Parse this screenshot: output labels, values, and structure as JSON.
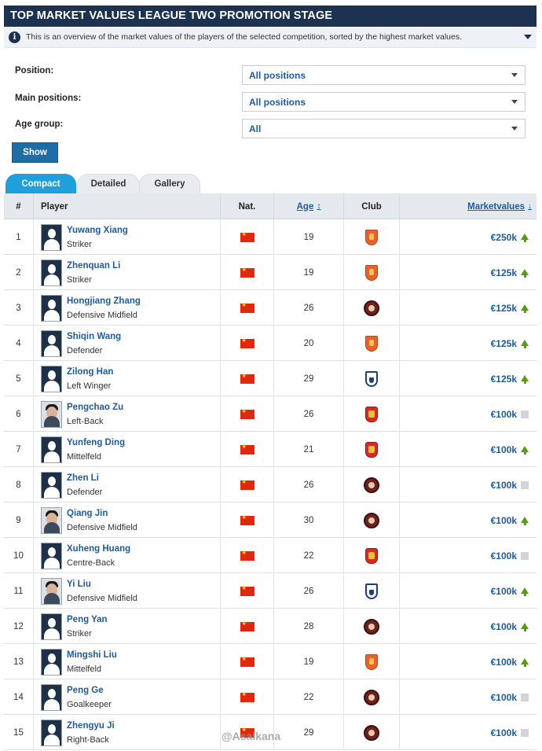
{
  "header": {
    "title": "TOP MARKET VALUES LEAGUE TWO PROMOTION STAGE",
    "info_text": "This is an overview of the market values of the players of the selected competition, sorted by the highest market values.",
    "info_icon": "info-icon"
  },
  "filters": {
    "position_label": "Position:",
    "position_value": "All positions",
    "main_positions_label": "Main positions:",
    "main_positions_value": "All positions",
    "age_group_label": "Age group:",
    "age_group_value": "All",
    "show_label": "Show"
  },
  "tabs": [
    {
      "label": "Compact",
      "active": true
    },
    {
      "label": "Detailed",
      "active": false
    },
    {
      "label": "Gallery",
      "active": false
    }
  ],
  "columns": {
    "num": "#",
    "player": "Player",
    "nat": "Nat.",
    "age": "Age",
    "club": "Club",
    "value": "Marketvalues"
  },
  "rows": [
    {
      "num": "1",
      "name": "Yuwang Xiang",
      "position": "Striker",
      "nat": "China",
      "age": "19",
      "club_crest": "orange",
      "value": "€250k",
      "trend": "up",
      "photo": false
    },
    {
      "num": "2",
      "name": "Zhenquan Li",
      "position": "Striker",
      "nat": "China",
      "age": "19",
      "club_crest": "orange",
      "value": "€125k",
      "trend": "up",
      "photo": false
    },
    {
      "num": "3",
      "name": "Hongjiang Zhang",
      "position": "Defensive Midfield",
      "nat": "China",
      "age": "26",
      "club_crest": "brown",
      "value": "€125k",
      "trend": "up",
      "photo": false
    },
    {
      "num": "4",
      "name": "Shiqin Wang",
      "position": "Defender",
      "nat": "China",
      "age": "20",
      "club_crest": "orange",
      "value": "€125k",
      "trend": "up",
      "photo": false
    },
    {
      "num": "5",
      "name": "Zilong Han",
      "position": "Left Winger",
      "nat": "China",
      "age": "29",
      "club_crest": "blue",
      "value": "€125k",
      "trend": "up",
      "photo": false
    },
    {
      "num": "6",
      "name": "Pengchao Zu",
      "position": "Left-Back",
      "nat": "China",
      "age": "26",
      "club_crest": "red",
      "value": "€100k",
      "trend": "none",
      "photo": true
    },
    {
      "num": "7",
      "name": "Yunfeng Ding",
      "position": "Mittelfeld",
      "nat": "China",
      "age": "21",
      "club_crest": "red",
      "value": "€100k",
      "trend": "up",
      "photo": false
    },
    {
      "num": "8",
      "name": "Zhen Li",
      "position": "Defender",
      "nat": "China",
      "age": "26",
      "club_crest": "brown",
      "value": "€100k",
      "trend": "none",
      "photo": false
    },
    {
      "num": "9",
      "name": "Qiang Jin",
      "position": "Defensive Midfield",
      "nat": "China",
      "age": "30",
      "club_crest": "brown",
      "value": "€100k",
      "trend": "up",
      "photo": true
    },
    {
      "num": "10",
      "name": "Xuheng Huang",
      "position": "Centre-Back",
      "nat": "China",
      "age": "22",
      "club_crest": "red",
      "value": "€100k",
      "trend": "none",
      "photo": false
    },
    {
      "num": "11",
      "name": "Yi Liu",
      "position": "Defensive Midfield",
      "nat": "China",
      "age": "26",
      "club_crest": "blue",
      "value": "€100k",
      "trend": "up",
      "photo": true
    },
    {
      "num": "12",
      "name": "Peng Yan",
      "position": "Striker",
      "nat": "China",
      "age": "28",
      "club_crest": "brown",
      "value": "€100k",
      "trend": "up",
      "photo": false
    },
    {
      "num": "13",
      "name": "Mingshi Liu",
      "position": "Mittelfeld",
      "nat": "China",
      "age": "19",
      "club_crest": "orange",
      "value": "€100k",
      "trend": "up",
      "photo": false
    },
    {
      "num": "14",
      "name": "Peng Ge",
      "position": "Goalkeeper",
      "nat": "China",
      "age": "22",
      "club_crest": "brown",
      "value": "€100k",
      "trend": "none",
      "photo": false
    },
    {
      "num": "15",
      "name": "Zhengyu Ji",
      "position": "Right-Back",
      "nat": "China",
      "age": "29",
      "club_crest": "brown",
      "value": "€100k",
      "trend": "none",
      "photo": false
    }
  ],
  "watermark": "@Asaikana",
  "colors": {
    "header_bg": "#1d3150",
    "link_blue": "#1d5b9c",
    "tab_active": "#1fa0dd",
    "button_bg": "#1f6da7",
    "trend_up": "#5a9a1a"
  }
}
